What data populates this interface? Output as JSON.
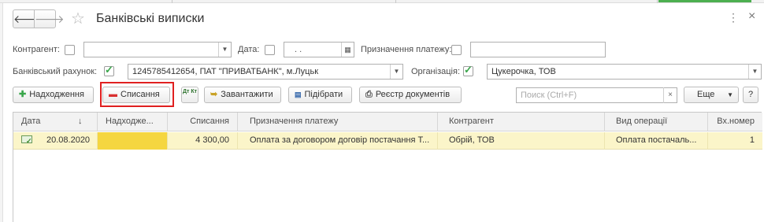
{
  "window": {
    "title": "Банківські виписки",
    "more_glyph": "⋮",
    "close_glyph": "×"
  },
  "nav": {
    "back_glyph": "🡐",
    "forward_glyph": "🡒",
    "star_glyph": "☆"
  },
  "filters": {
    "counterparty_label": "Контрагент:",
    "counterparty_value": "",
    "date_label": "Дата:",
    "date_value": " .  .",
    "purpose_label": "Призначення платежу:",
    "purpose_value": "",
    "bank_account_label": "Банківський рахунок:",
    "bank_account_checked": true,
    "bank_account_value": "1245785412654, ПАТ \"ПРИВАТБАНК\", м.Луцьк",
    "organization_label": "Організація:",
    "organization_checked": true,
    "organization_value": "Цукерочка, ТОВ"
  },
  "toolbar": {
    "receipt_label": "Надходження",
    "writeoff_label": "Списання",
    "dtkt_icon_label": "Дт Кт",
    "load_label": "Завантажити",
    "select_label": "Підібрати",
    "registry_label": "Реєстр документів",
    "search_placeholder": "Поиск (Ctrl+F)",
    "search_clear": "×",
    "more_label": "Еще",
    "help_label": "?"
  },
  "table": {
    "columns": [
      "Дата",
      "Надходже...",
      "Списання",
      "Призначення платежу",
      "Контрагент",
      "Вид операції",
      "Вх.номер"
    ],
    "sort_glyph": "↓",
    "rows": [
      {
        "date": "20.08.2020",
        "receipt": "",
        "writeoff": "4 300,00",
        "purpose": "Оплата за договором договір постачання Т...",
        "counterparty": "Обрій, ТОВ",
        "operation": "Оплата постачаль...",
        "in_number": "1"
      }
    ]
  },
  "colors": {
    "highlight_row": "#fbf5c9",
    "selected_cell": "#f5d640",
    "focus_box": "#e02020",
    "accent_green": "#3aa64b"
  }
}
